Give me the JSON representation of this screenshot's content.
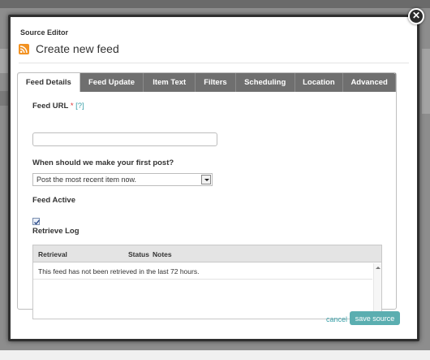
{
  "dialog": {
    "editor_title": "Source Editor",
    "feed_title": "Create new feed",
    "close_glyph": "✕"
  },
  "tabs": [
    {
      "label": "Feed Details",
      "active": true
    },
    {
      "label": "Feed Update",
      "active": false
    },
    {
      "label": "Item Text",
      "active": false
    },
    {
      "label": "Filters",
      "active": false
    },
    {
      "label": "Scheduling",
      "active": false
    },
    {
      "label": "Location",
      "active": false
    },
    {
      "label": "Advanced",
      "active": false
    }
  ],
  "form": {
    "feed_url_label": "Feed URL",
    "required_mark": "*",
    "help_link": "[?]",
    "feed_url_value": "",
    "first_post_label": "When should we make your first post?",
    "first_post_value": "Post the most recent item now.",
    "feed_active_label": "Feed Active",
    "feed_active_checked": true,
    "retrieve_log_label": "Retrieve Log"
  },
  "log": {
    "columns": [
      "Retrieval",
      "Status",
      "Notes"
    ],
    "rows": [
      "This feed has not been retrieved in the last 72 hours."
    ]
  },
  "footer": {
    "cancel_label": "cancel",
    "save_label": "save source"
  },
  "colors": {
    "accent": "#5aaeb0",
    "link": "#3aa0a8",
    "tabbar": "#6f6f6f",
    "rss": "#f29222"
  },
  "icons": [
    "rss-icon",
    "close-icon",
    "checkmark-icon",
    "chevron-down-icon"
  ]
}
